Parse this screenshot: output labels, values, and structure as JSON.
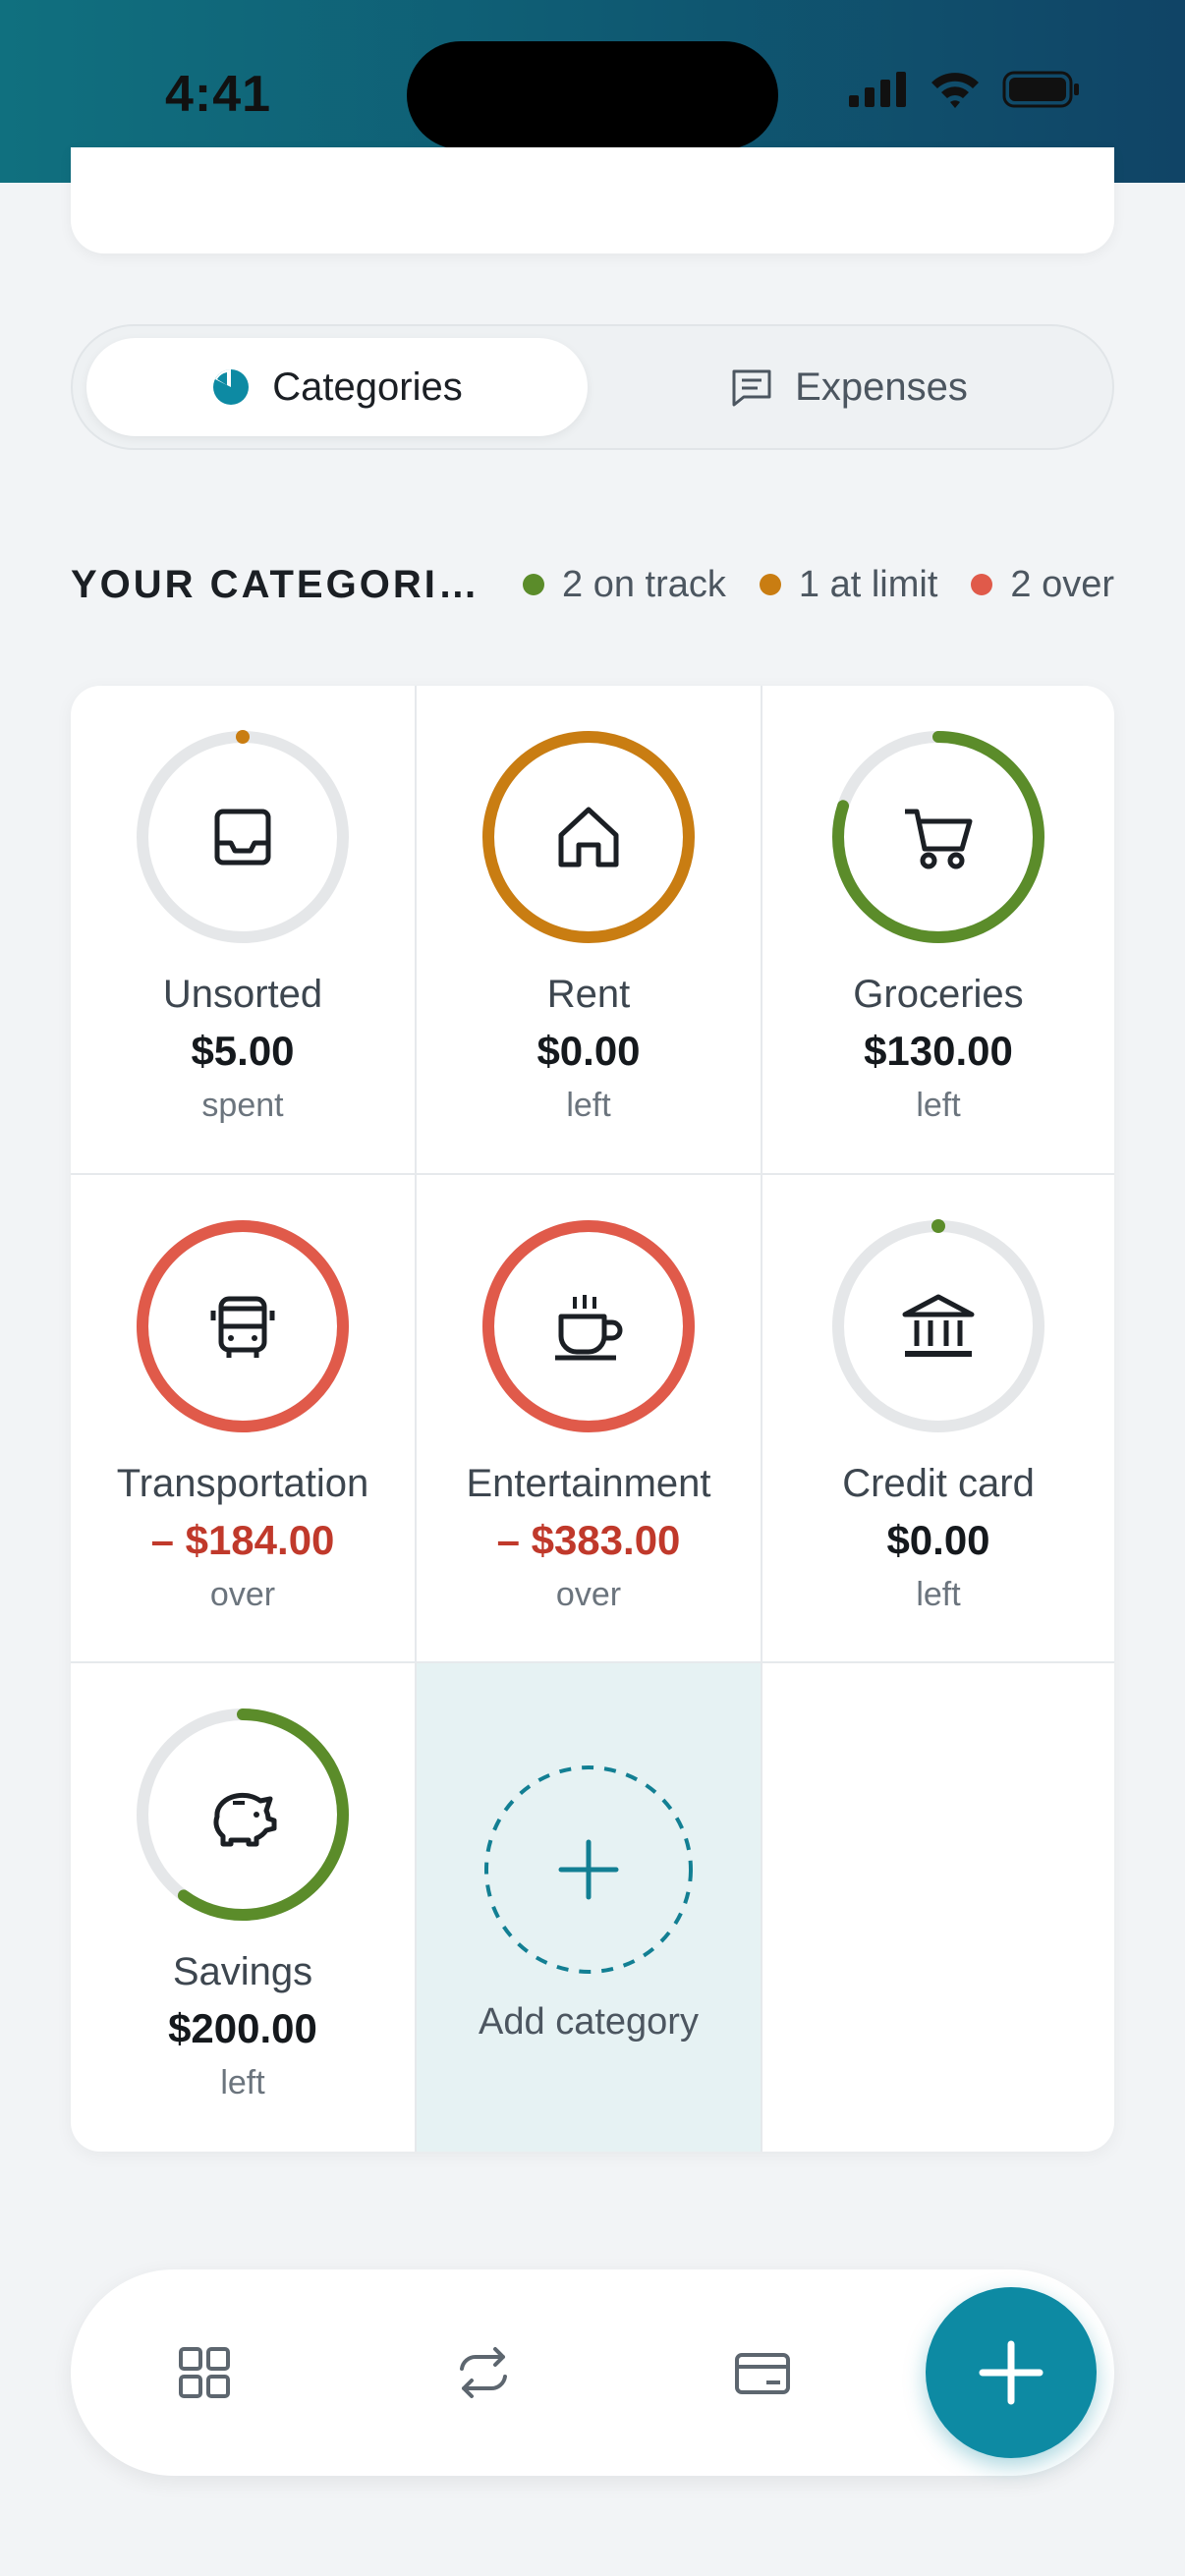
{
  "status_bar": {
    "time": "4:41"
  },
  "tabs": [
    {
      "label": "Categories",
      "icon": "pie-chart-icon",
      "active": true
    },
    {
      "label": "Expenses",
      "icon": "receipt-icon",
      "active": false
    }
  ],
  "section": {
    "title": "YOUR CATEGORI…",
    "legend": [
      {
        "label": "2 on track",
        "color": "#5b8c2a"
      },
      {
        "label": "1 at limit",
        "color": "#c97d12"
      },
      {
        "label": "2 over",
        "color": "#e05a4a"
      }
    ]
  },
  "colors": {
    "on_track": "#5b8c2a",
    "at_limit": "#c97d12",
    "over": "#e05a4a",
    "track": "#e5e7e9",
    "accent": "#0d8aa3",
    "over_text": "#c0392b"
  },
  "categories": [
    {
      "name": "Unsorted",
      "amount": "$5.00",
      "note": "spent",
      "icon": "inbox-tray-icon",
      "status": "at_limit",
      "progress": 0.0
    },
    {
      "name": "Rent",
      "amount": "$0.00",
      "note": "left",
      "icon": "house-icon",
      "status": "at_limit",
      "progress": 1.0
    },
    {
      "name": "Groceries",
      "amount": "$130.00",
      "note": "left",
      "icon": "shopping-cart-icon",
      "status": "on_track",
      "progress": 0.8
    },
    {
      "name": "Transportation",
      "amount": "– $184.00",
      "note": "over",
      "icon": "bus-icon",
      "status": "over",
      "progress": 1.0
    },
    {
      "name": "Entertainment",
      "amount": "– $383.00",
      "note": "over",
      "icon": "coffee-cup-icon",
      "status": "over",
      "progress": 1.0
    },
    {
      "name": "Credit card",
      "amount": "$0.00",
      "note": "left",
      "icon": "bank-icon",
      "status": "on_track",
      "progress": 0.0
    },
    {
      "name": "Savings",
      "amount": "$200.00",
      "note": "left",
      "icon": "piggy-bank-icon",
      "status": "on_track",
      "progress": 0.6
    }
  ],
  "add_category": {
    "label": "Add category",
    "icon": "plus-icon"
  },
  "bottom_nav": {
    "items": [
      {
        "icon": "grid-icon"
      },
      {
        "icon": "repeat-icon"
      },
      {
        "icon": "card-icon"
      }
    ],
    "fab_icon": "plus-icon"
  }
}
